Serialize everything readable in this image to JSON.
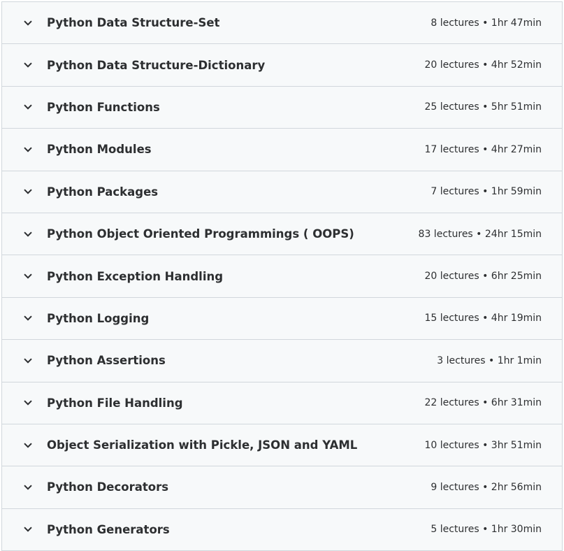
{
  "sections": [
    {
      "title": "Python Data Structure-Set",
      "meta": "8 lectures • 1hr 47min"
    },
    {
      "title": "Python Data Structure-Dictionary",
      "meta": "20 lectures • 4hr 52min"
    },
    {
      "title": "Python Functions",
      "meta": "25 lectures • 5hr 51min"
    },
    {
      "title": "Python Modules",
      "meta": "17 lectures • 4hr 27min"
    },
    {
      "title": "Python Packages",
      "meta": "7 lectures • 1hr 59min"
    },
    {
      "title": "Python Object Oriented Programmings ( OOPS)",
      "meta": "83 lectures • 24hr 15min"
    },
    {
      "title": "Python Exception Handling",
      "meta": "20 lectures • 6hr 25min"
    },
    {
      "title": "Python Logging",
      "meta": "15 lectures • 4hr 19min"
    },
    {
      "title": "Python Assertions",
      "meta": "3 lectures • 1hr 1min"
    },
    {
      "title": "Python File Handling",
      "meta": "22 lectures • 6hr 31min"
    },
    {
      "title": "Object Serialization with Pickle, JSON and YAML",
      "meta": "10 lectures • 3hr 51min"
    },
    {
      "title": "Python Decorators",
      "meta": "9 lectures • 2hr 56min"
    },
    {
      "title": "Python Generators",
      "meta": "5 lectures • 1hr 30min"
    }
  ],
  "icons": {
    "toggle": "chevron-down-icon"
  },
  "colors": {
    "row_background": "#f7f9fa",
    "border": "#d1d7dc",
    "text": "#2d2f31"
  }
}
